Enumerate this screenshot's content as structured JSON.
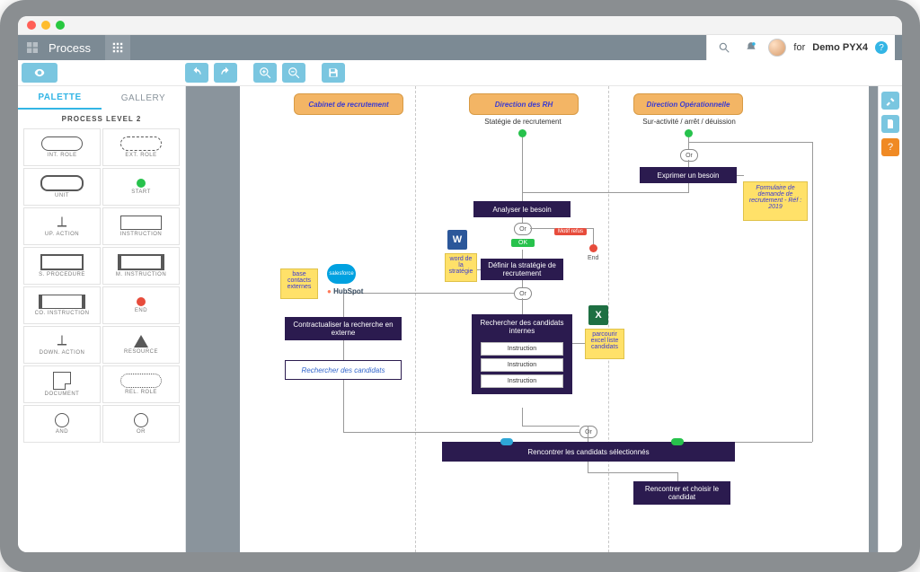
{
  "app": {
    "title": "Process",
    "user_prefix": "for",
    "user_name": "Demo PYX4"
  },
  "topbar_icons": {
    "search": "search",
    "notifications": "bell",
    "help": "?"
  },
  "toolbar": {
    "eye": "view",
    "undo": "↶",
    "redo": "↷",
    "zoom_in": "+",
    "zoom_out": "−",
    "save": "💾"
  },
  "palette": {
    "tabs": {
      "palette": "PALETTE",
      "gallery": "GALLERY"
    },
    "heading": "PROCESS LEVEL 2",
    "items": [
      "INT. ROLE",
      "EXT. ROLE",
      "UNIT",
      "START",
      "UP. ACTION",
      "INSTRUCTION",
      "S. PROCEDURE",
      "M. INSTRUCTION",
      "CO. INSTRUCTION",
      "END",
      "DOWN. ACTION",
      "RESOURCE",
      "DOCUMENT",
      "REL. ROLE",
      "AND",
      "OR"
    ]
  },
  "lanes": {
    "lane1": "Cabinet de recrutement",
    "lane2": "Direction des RH",
    "lane3": "Direction Opérationnelle"
  },
  "diagram": {
    "start1": "Statégie de recrutement",
    "start2": "Sur-activité / arrêt / déuission",
    "or_label": "Or",
    "exprimer": "Exprimer un besoin",
    "formulaire": "Formulaire de demande de recrutement - Réf : 2019",
    "analyser": "Analyser le besoin",
    "ok": "OK",
    "motif_refus": "Motif refus",
    "end": "End",
    "word_note": "word de la stratégie",
    "definir": "Définir la stratégie de recrutement",
    "base_contacts": "base contacts externes",
    "salesforce": "salesforce",
    "hubspot": "HubSpot",
    "contractualiser": "Contractualiser la recherche en externe",
    "rechercher_candidats": "Rechercher des candidats",
    "rechercher_internes_header": "Rechercher des candidats internes",
    "instruction1": "Instruction",
    "instruction2": "Instruction",
    "instruction3": "Instruction",
    "excel_note": "parcourir excel liste candidats",
    "rencontrer_sel": "Rencontrer les candidats sélectionnés",
    "rencontrer_choisir": "Rencontrer et choisir le candidat"
  },
  "right_rail": {
    "tools": "tools",
    "doc": "file",
    "help": "?"
  }
}
